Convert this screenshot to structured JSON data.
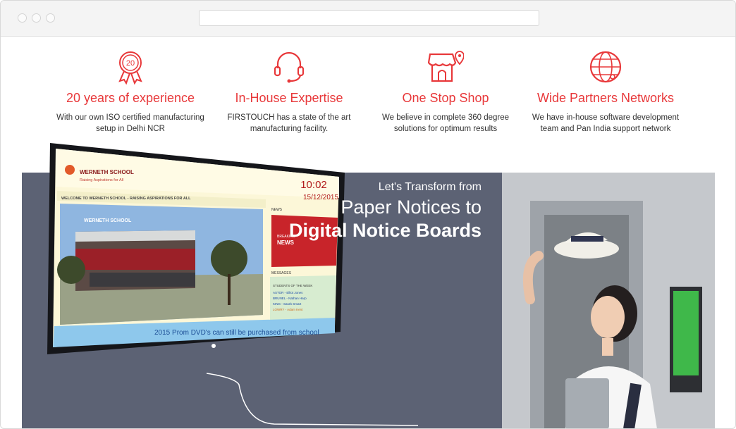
{
  "features": [
    {
      "icon": "badge-20-icon",
      "title": "20 years of experience",
      "desc_line1": "With our own ISO certified manufacturing",
      "desc_line2": "setup in Delhi NCR",
      "badge_number": "20"
    },
    {
      "icon": "headset-icon",
      "title": "In-House Expertise",
      "desc_line1": "FIRSTOUCH has a state of the art",
      "desc_line2": "manufacturing facility."
    },
    {
      "icon": "shop-icon",
      "title": "One Stop Shop",
      "desc_line1": "We believe in complete 360 degree",
      "desc_line2": "solutions for optimum results"
    },
    {
      "icon": "globe-icon",
      "title": "Wide Partners Networks",
      "desc_line1": "We have in-house software development",
      "desc_line2": "team and Pan India support network"
    }
  ],
  "banner": {
    "line1": "Let's Transform from",
    "line2": "Paper Notices to",
    "line3": "Digital Notice Boards"
  },
  "display": {
    "school_name": "WERNETH SCHOOL",
    "school_tagline": "Raising Aspirations for All",
    "time": "10:02",
    "date": "15/12/2015",
    "welcome": "WELCOME TO WERNETH SCHOOL - RAISING ASPIRATIONS FOR ALL",
    "building_sign": "WERNETH SCHOOL",
    "news_label": "NEWS",
    "breaking": "BREAKING",
    "news_tile": "NEWS",
    "messages_label": "MESSAGES",
    "students_label": "STUDENTS OF THE WEEK",
    "students": [
      "ASTOR - Elliot Jones",
      "BRUNEL - Nathan Harp",
      "KING - Sarah Smart",
      "LOWRY - Adam Kent"
    ],
    "ticker": "2015 Prom DVD's can still be purchased from school"
  },
  "colors": {
    "accent": "#e8383a",
    "panel": "#5c6274"
  }
}
